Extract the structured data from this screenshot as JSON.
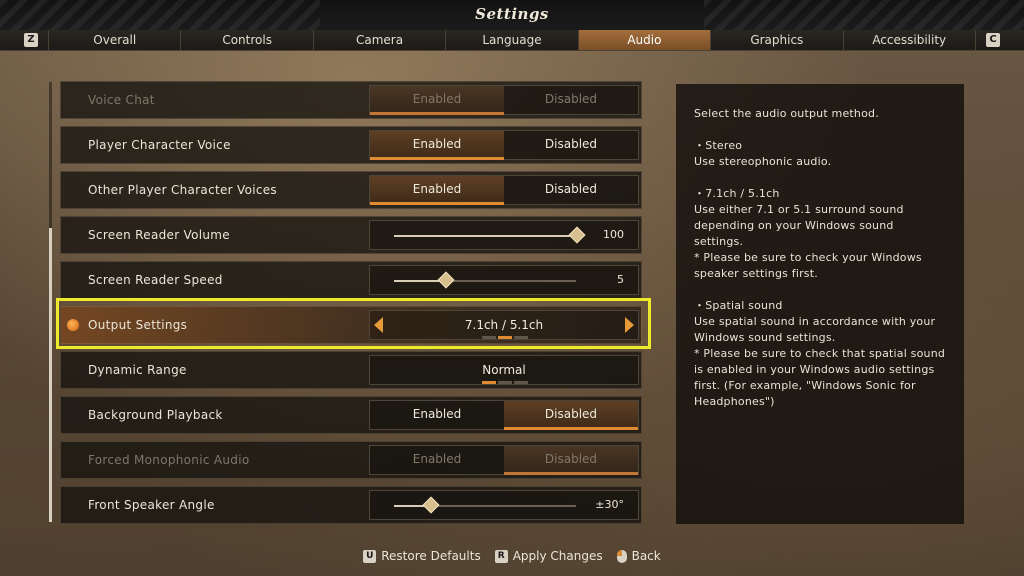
{
  "header": {
    "title": "Settings"
  },
  "tabbar": {
    "prev_key": "Z",
    "next_key": "C",
    "tabs": [
      {
        "label": "Overall",
        "active": false
      },
      {
        "label": "Controls",
        "active": false
      },
      {
        "label": "Camera",
        "active": false
      },
      {
        "label": "Language",
        "active": false
      },
      {
        "label": "Audio",
        "active": true
      },
      {
        "label": "Graphics",
        "active": false
      },
      {
        "label": "Accessibility",
        "active": false
      }
    ]
  },
  "settings": {
    "voice_chat": {
      "label": "Voice Chat",
      "enabled": "Enabled",
      "disabled": "Disabled",
      "selected": "Enabled",
      "state": "disabled"
    },
    "player_voice": {
      "label": "Player Character Voice",
      "enabled": "Enabled",
      "disabled": "Disabled",
      "selected": "Enabled"
    },
    "other_voices": {
      "label": "Other Player Character Voices",
      "enabled": "Enabled",
      "disabled": "Disabled",
      "selected": "Enabled"
    },
    "reader_volume": {
      "label": "Screen Reader Volume",
      "value": "100",
      "level": 1.0
    },
    "reader_speed": {
      "label": "Screen Reader Speed",
      "value": "5",
      "level": 0.28
    },
    "output": {
      "label": "Output Settings",
      "value": "7.1ch / 5.1ch",
      "option_count": 3,
      "option_index": 1
    },
    "dynamic_range": {
      "label": "Dynamic Range",
      "value": "Normal",
      "option_count": 3,
      "option_index": 0
    },
    "background_playback": {
      "label": "Background Playback",
      "enabled": "Enabled",
      "disabled": "Disabled",
      "selected": "Disabled"
    },
    "forced_mono": {
      "label": "Forced Monophonic Audio",
      "enabled": "Enabled",
      "disabled": "Disabled",
      "selected": "Disabled",
      "state": "disabled"
    },
    "front_angle": {
      "label": "Front Speaker Angle",
      "value": "±30°",
      "level": 0.2
    }
  },
  "description": {
    "intro": "Select the audio output method.",
    "stereo": "・Stereo\nUse stereophonic audio.",
    "surround": "・7.1ch / 5.1ch\nUse either 7.1 or 5.1 surround sound depending on your Windows sound settings.\n* Please be sure to check your Windows speaker settings first.",
    "spatial": "・Spatial sound\nUse spatial sound in accordance with your Windows sound settings.\n* Please be sure to check that spatial sound is enabled in your Windows audio settings first. (For example, \"Windows Sonic for Headphones\")"
  },
  "footer": {
    "restore": {
      "key": "U",
      "label": "Restore Defaults"
    },
    "apply": {
      "key": "R",
      "label": "Apply Changes"
    },
    "back": {
      "icon": "mouse-icon",
      "label": "Back"
    }
  },
  "colors": {
    "accent": "#e08a34",
    "focus": "#ecea2b",
    "active_tab": "#a46e3c"
  }
}
